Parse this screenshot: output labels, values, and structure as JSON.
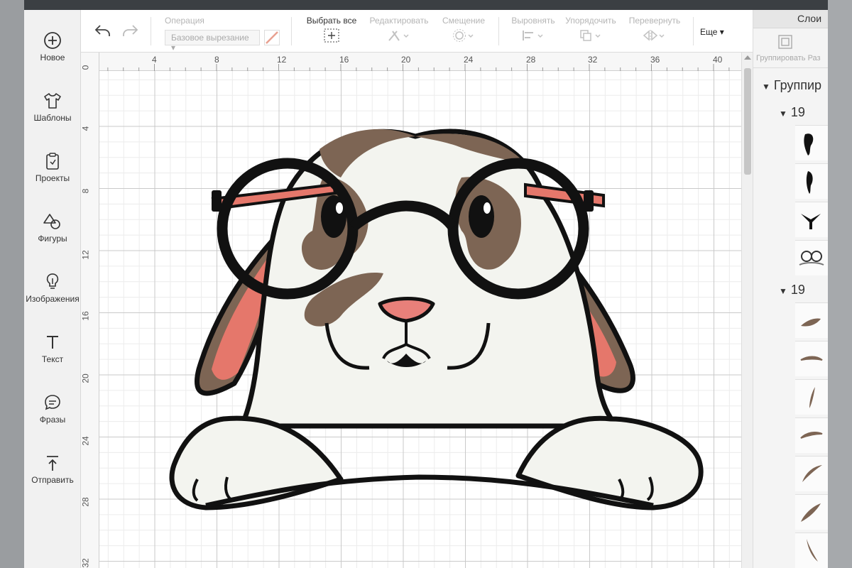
{
  "sidebar": {
    "items": [
      {
        "label": "Новое",
        "icon": "plus-circle-icon"
      },
      {
        "label": "Шаблоны",
        "icon": "tshirt-icon"
      },
      {
        "label": "Проекты",
        "icon": "clipboard-icon"
      },
      {
        "label": "Фигуры",
        "icon": "shapes-icon"
      },
      {
        "label": "Изображения",
        "icon": "lightbulb-icon"
      },
      {
        "label": "Текст",
        "icon": "text-icon"
      },
      {
        "label": "Фразы",
        "icon": "speech-bubble-icon"
      },
      {
        "label": "Отправить",
        "icon": "upload-icon"
      }
    ]
  },
  "toolbar": {
    "operation_label": "Операция",
    "operation_value": "Базовое вырезание",
    "select_all": "Выбрать все",
    "edit": "Редактировать",
    "offset": "Смещение",
    "align": "Выровнять",
    "arrange": "Упорядочить",
    "flip": "Перевернуть",
    "more": "Еще"
  },
  "layers": {
    "title": "Слои",
    "group_tool": "Группировать",
    "ungroup_tool": "Раз",
    "top_group": "Группир",
    "subgroup1": "19",
    "subgroup2": "19"
  },
  "ruler": {
    "top": [
      "4",
      "8",
      "12",
      "16",
      "20",
      "24",
      "28",
      "32",
      "36",
      "40"
    ],
    "left": [
      "0",
      "4",
      "8",
      "12",
      "16",
      "20",
      "24",
      "28",
      "32"
    ]
  },
  "colors": {
    "fur_brown": "#7d6554",
    "ear_pink": "#e5776b",
    "nose_pink": "#e8807a",
    "body_white": "#f3f4ef",
    "outline": "#111111"
  }
}
